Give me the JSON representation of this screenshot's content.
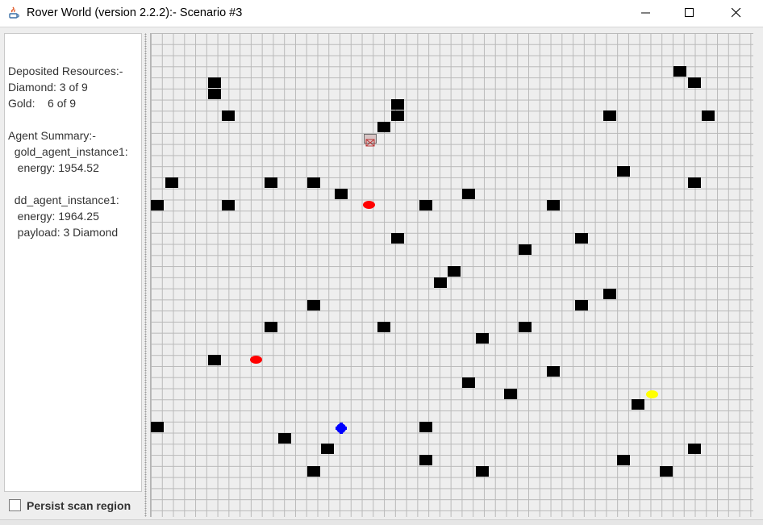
{
  "window": {
    "title": "Rover World (version 2.2.2):- Scenario #3",
    "icons": {
      "app": "java-cup-icon",
      "minimize": "minimize-icon",
      "maximize": "maximize-icon",
      "close": "close-icon"
    }
  },
  "info_panel": {
    "lines": [
      "Deposited Resources:-",
      "Diamond: 3 of 9",
      "Gold:    6 of 9",
      "",
      "Agent Summary:-",
      "  gold_agent_instance1:",
      "   energy: 1954.52",
      "",
      "  dd_agent_instance1:",
      "   energy: 1964.25",
      "   payload: 3 Diamond"
    ]
  },
  "persist_scan": {
    "label": "Persist scan region",
    "checked": false
  },
  "colors": {
    "obstacle": "#000000",
    "diamond_resource": "#ff0000",
    "gold_resource": "#ffff00",
    "rover": "#0000ff",
    "grid_background": "#eeeeee",
    "grid_lines": "#b9b9b9"
  }
}
